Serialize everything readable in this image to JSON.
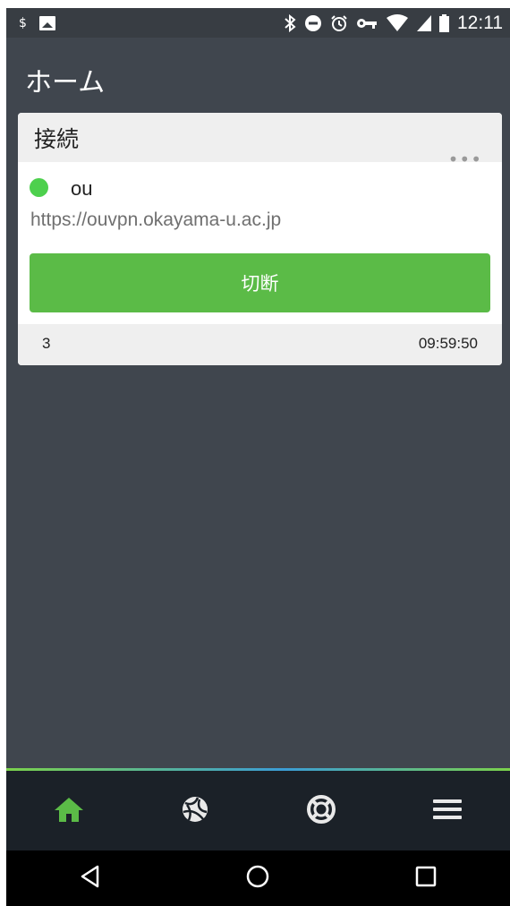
{
  "status_bar": {
    "time": "12:11",
    "left_icons": [
      "dollar-icon",
      "image-icon"
    ],
    "right_icons": [
      "bluetooth-icon",
      "do-not-disturb-icon",
      "alarm-icon",
      "vpn-key-icon",
      "wifi-icon",
      "signal-icon",
      "battery-icon"
    ]
  },
  "header": {
    "title": "ホーム"
  },
  "card": {
    "title": "接続",
    "connection": {
      "name": "ou",
      "url": "https://ouvpn.okayama-u.ac.jp",
      "status_color": "#4dd04d",
      "more_label": "•••"
    },
    "disconnect_label": "切断",
    "footer": {
      "left": "3",
      "right": "09:59:50"
    }
  },
  "bottom_nav": {
    "items": [
      "home-icon",
      "network-icon",
      "support-icon",
      "menu-icon"
    ],
    "active_color": "#5bbb47"
  },
  "colors": {
    "accent": "#5bbb47",
    "background": "#40464e",
    "nav_background": "#1b2128"
  }
}
